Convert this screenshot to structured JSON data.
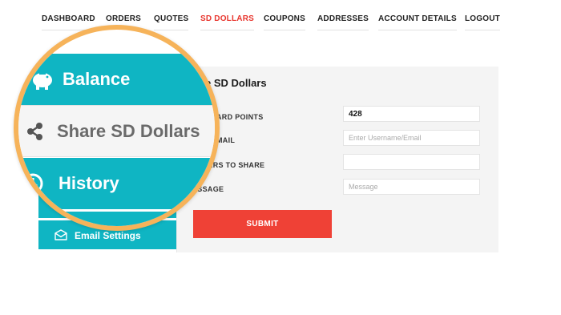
{
  "nav": {
    "items": [
      "DASHBOARD",
      "ORDERS",
      "QUOTES",
      "SD DOLLARS",
      "COUPONS",
      "ADDRESSES",
      "ACCOUNT DETAILS",
      "LOGOUT"
    ],
    "active": "SD DOLLARS"
  },
  "sidebar": {
    "balance": "Balance",
    "share": "Share SD Dollars",
    "history": "History",
    "email_settings": "Email Settings"
  },
  "form": {
    "title_fragment": "e SD Dollars",
    "reward_label": "T REWARD POINTS",
    "reward_value": "428",
    "username_label": "AME/EMAIL",
    "username_placeholder": "Enter Username/Email",
    "dollars_label": "OLLARS TO SHARE",
    "dollars_value": "",
    "message_label": "ESSAGE",
    "message_placeholder": "Message",
    "submit_label": "SUBMIT"
  },
  "colors": {
    "accent": "#0fb5c3",
    "active_nav": "#e8352d",
    "submit": "#ef4136",
    "magnifier_ring": "#f6b35a"
  },
  "icons": {
    "balance": "piggy-bank-icon",
    "share": "share-icon",
    "history": "clock-icon",
    "email": "envelope-open-icon"
  }
}
